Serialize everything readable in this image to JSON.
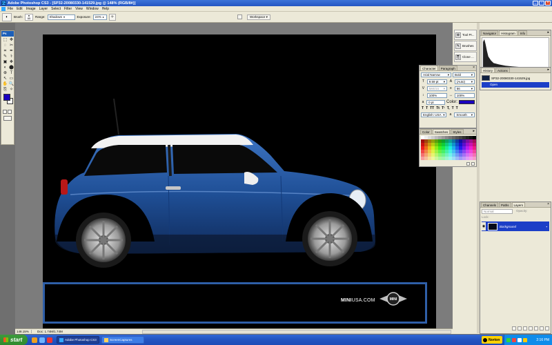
{
  "window": {
    "title": "Adobe Photoshop CS3 - [SP32-20080330-141529.jpg @ 148% (RGB/8#)]",
    "app_icon_label": "Ps"
  },
  "menu": [
    "File",
    "Edit",
    "Image",
    "Layer",
    "Select",
    "Filter",
    "View",
    "Window",
    "Help"
  ],
  "options_bar": {
    "brush_label": "Brush:",
    "brush_size": "65",
    "range_label": "Range:",
    "range_value": "Shadows",
    "exposure_label": "Exposure:",
    "exposure_value": "24%",
    "workspace_label": "Workspace ▾"
  },
  "tools": {
    "logo": "Ps",
    "icons": [
      "⬚",
      "✥",
      "◌",
      "✂",
      "⌗",
      "✒",
      "✎",
      "⚕",
      "▣",
      "❖",
      "◐",
      "⬤",
      "⊕",
      "T",
      "↖",
      "▭",
      "✋",
      "🔍",
      "⎘",
      "✧"
    ],
    "foreground_color": "#1a00c0",
    "background_color": "#ffffff"
  },
  "canvas": {
    "banner_url_bold": "MINI",
    "banner_url_rest": "USA.COM",
    "logo_text": "MINI"
  },
  "status": {
    "zoom": "148.15%",
    "doc_size": "Doc: 1.74M/1.74M"
  },
  "mini_dock": [
    {
      "icon": "⊕",
      "label": "Tool Pr..."
    },
    {
      "icon": "✎",
      "label": "Brushes"
    },
    {
      "icon": "⎘",
      "label": "Clone ..."
    }
  ],
  "navigator_panel": {
    "tabs": [
      "Navigator",
      "Histogram",
      "Info"
    ],
    "active_tab": 1
  },
  "history_panel": {
    "tabs": [
      "History",
      "Actions"
    ],
    "snapshot_label": "SP32-20080330-141529.jpg",
    "step_label": "Open"
  },
  "character_panel": {
    "tabs": [
      "Character",
      "Paragraph"
    ],
    "font_family": "Arial Narrow",
    "font_style": "Bold",
    "font_size": "9.59 pt",
    "leading": "(Auto)",
    "kerning": "Metrics",
    "tracking": "56",
    "vertical_scale": "100%",
    "horizontal_scale": "100%",
    "baseline_shift": "0 pt",
    "color_label": "Color:",
    "color_value": "#1a00c0",
    "style_buttons": [
      "T",
      "T",
      "TT",
      "Tt",
      "T¹",
      "T,",
      "T",
      "T"
    ],
    "language": "English: USA",
    "antialias": "Smooth"
  },
  "swatches_panel": {
    "tabs": [
      "Color",
      "Swatches",
      "Styles"
    ],
    "active_tab": 1
  },
  "layers_panel": {
    "tabs": [
      "Channels",
      "Paths",
      "Layers"
    ],
    "active_tab": 2,
    "blend_mode": "Normal",
    "opacity_label": "Opacity:",
    "lock_label": "Lock:",
    "layer_name": "Background"
  },
  "taskbar": {
    "start_label": "start",
    "tasks": [
      "Adobe Photoshop CS3",
      "ScreenCaptures"
    ],
    "norton_label": "Norton",
    "clock": "2:16 PM"
  }
}
